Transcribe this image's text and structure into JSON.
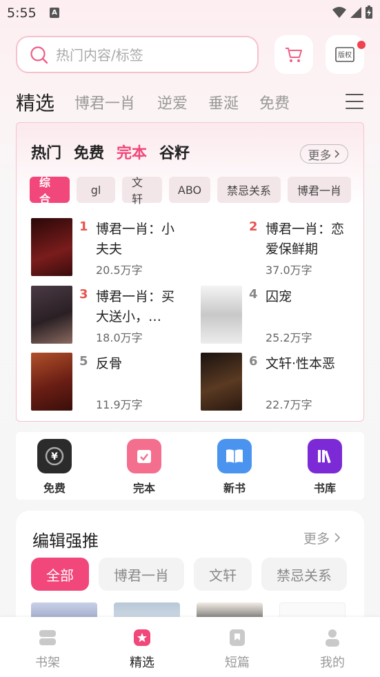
{
  "status": {
    "time": "5:55",
    "sim_label": "A"
  },
  "search": {
    "placeholder": "热门内容/标签"
  },
  "top_tabs": [
    "精选",
    "博君一肖",
    "逆爱",
    "垂涎",
    "免费"
  ],
  "ranking": {
    "categories": [
      "热门",
      "免费",
      "完本",
      "谷籽"
    ],
    "active_category": "完本",
    "more_label": "更多",
    "chips": [
      "综合",
      "gl",
      "文轩",
      "ABO",
      "禁忌关系",
      "博君一肖"
    ],
    "books": [
      {
        "rank": "1",
        "title": "博君一肖：小夫夫",
        "words": "20.5万字",
        "cover_color": "#5a1414"
      },
      {
        "rank": "2",
        "title": "博君一肖：恋爱保鲜期",
        "words": "37.0万字",
        "cover_color": "#ffffff"
      },
      {
        "rank": "3",
        "title": "博君一肖：买大送小，…",
        "words": "18.0万字",
        "cover_color": "#3a2f3a"
      },
      {
        "rank": "4",
        "title": "囚宠",
        "words": "25.2万字",
        "cover_color": "#e8e8e8"
      },
      {
        "rank": "5",
        "title": "反骨",
        "words": "11.9万字",
        "cover_color": "#7a2a1e"
      },
      {
        "rank": "6",
        "title": "文轩·性本恶",
        "words": "22.7万字",
        "cover_color": "#2a1a14"
      }
    ]
  },
  "quick_links": [
    {
      "label": "免费",
      "icon": "yen-icon",
      "color": "#2b2b2b"
    },
    {
      "label": "完本",
      "icon": "check-calendar-icon",
      "color": "#f46e8e"
    },
    {
      "label": "新书",
      "icon": "open-book-icon",
      "color": "#4a94f0"
    },
    {
      "label": "书库",
      "icon": "library-icon",
      "color": "#7b2ad6"
    }
  ],
  "editor": {
    "title": "编辑强推",
    "more_label": "更多",
    "chips": [
      "全部",
      "博君一肖",
      "文轩",
      "禁忌关系"
    ]
  },
  "bottom_nav": [
    {
      "label": "书架",
      "icon": "bookshelf-icon"
    },
    {
      "label": "精选",
      "icon": "star-icon"
    },
    {
      "label": "短篇",
      "icon": "book-icon"
    },
    {
      "label": "我的",
      "icon": "user-icon"
    }
  ],
  "colors": {
    "accent": "#f1477a",
    "rank_hot": "#e8544e"
  }
}
